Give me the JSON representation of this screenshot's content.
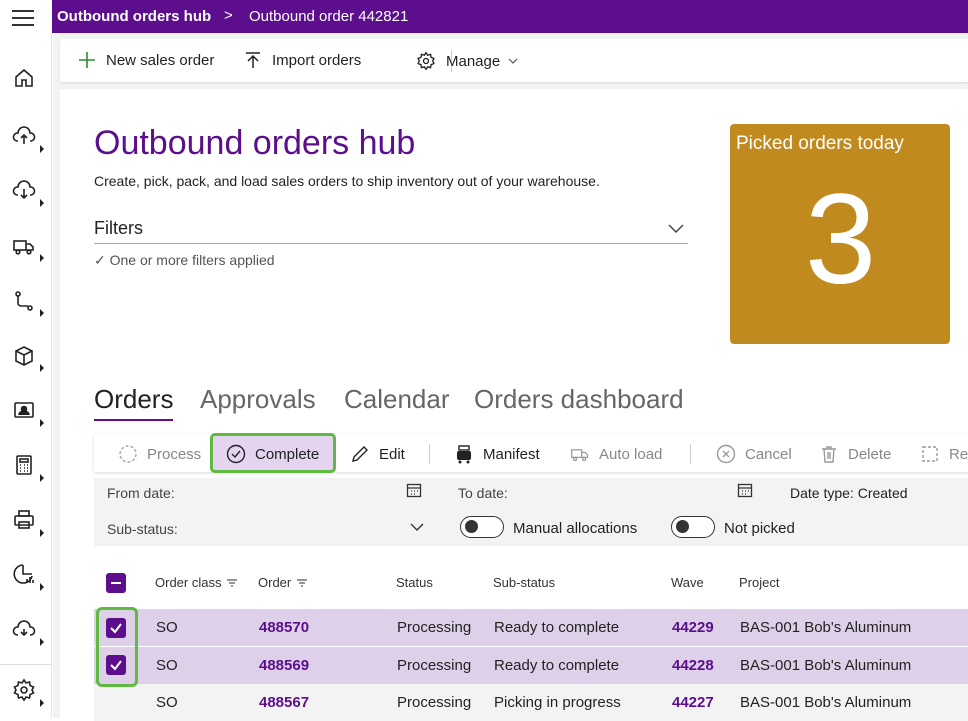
{
  "breadcrumb": {
    "root": "Outbound orders hub",
    "separator": ">",
    "current": "Outbound order 442821"
  },
  "sidebar": {
    "items": [
      {
        "icon": "home-icon"
      },
      {
        "icon": "cloud-upload-icon"
      },
      {
        "icon": "cloud-download-icon"
      },
      {
        "icon": "truck-icon"
      },
      {
        "icon": "route-icon"
      },
      {
        "icon": "box-icon"
      },
      {
        "icon": "id-card-icon"
      },
      {
        "icon": "calculator-icon"
      },
      {
        "icon": "printer-icon"
      },
      {
        "icon": "report-icon"
      },
      {
        "icon": "cloud-sync-icon"
      },
      {
        "icon": "gear-icon"
      }
    ]
  },
  "actionbar": {
    "new_label": "New sales order",
    "import_label": "Import orders",
    "manage_label": "Manage"
  },
  "page": {
    "title": "Outbound orders hub",
    "subtitle": "Create, pick, pack, and load sales orders to ship inventory out of your warehouse.",
    "filters_label": "Filters",
    "filters_note": "✓ One or more filters applied"
  },
  "tile": {
    "title": "Picked orders today",
    "value": "3",
    "color": "#c08a1e"
  },
  "tabs": [
    "Orders",
    "Approvals",
    "Calendar",
    "Orders dashboard"
  ],
  "toolbar": {
    "process": "Process",
    "complete": "Complete",
    "edit": "Edit",
    "manifest": "Manifest",
    "auto_load": "Auto load",
    "cancel": "Cancel",
    "delete": "Delete",
    "more": "Re"
  },
  "filters": {
    "from_date": "From date:",
    "to_date": "To date:",
    "date_type": "Date type: Created",
    "sub_status": "Sub-status:",
    "manual_allocations": "Manual allocations",
    "not_picked": "Not picked"
  },
  "grid": {
    "columns": [
      "Order class",
      "Order",
      "Status",
      "Sub-status",
      "Wave",
      "Project"
    ],
    "rows": [
      {
        "order_class": "SO",
        "order": "488570",
        "status": "Processing",
        "sub_status": "Ready to complete",
        "wave": "44229",
        "project": "BAS-001 Bob's Aluminum",
        "selected": true
      },
      {
        "order_class": "SO",
        "order": "488569",
        "status": "Processing",
        "sub_status": "Ready to complete",
        "wave": "44228",
        "project": "BAS-001 Bob's Aluminum",
        "selected": true
      },
      {
        "order_class": "SO",
        "order": "488567",
        "status": "Processing",
        "sub_status": "Picking in progress",
        "wave": "44227",
        "project": "BAS-001 Bob's Aluminum",
        "selected": false
      }
    ]
  },
  "colors": {
    "brand": "#5c0e8c",
    "highlight": "#5fbb3f",
    "selected_row": "#ddd0e8"
  }
}
